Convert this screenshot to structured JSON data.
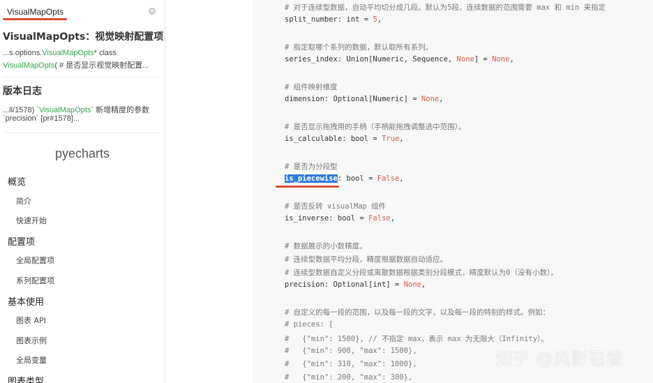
{
  "search": {
    "query": "VisualMapOpts",
    "clear_icon": "⊗"
  },
  "results": [
    {
      "title": "VisualMapOpts：视觉映射配置项",
      "line1_pre": "...s.options.",
      "line1_hl": "VisualMapOpts",
      "line1_post": "* class",
      "line2_hl": "VisualMapOpts",
      "line2_post": "( # 是否显示视觉映射配置..."
    },
    {
      "title": "版本日志",
      "line1_pre": "...ll/1578) `",
      "line1_hl": "VisualMapOpts",
      "line1_post": "` 新增精度的参数",
      "line2": "`precision` [pr#1578]..."
    }
  ],
  "brand": "pyecharts",
  "nav": [
    {
      "label": "概览",
      "level": "section"
    },
    {
      "label": "简介",
      "level": "sub"
    },
    {
      "label": "快速开始",
      "level": "sub"
    },
    {
      "label": "配置项",
      "level": "section"
    },
    {
      "label": "全局配置项",
      "level": "sub"
    },
    {
      "label": "系列配置项",
      "level": "sub"
    },
    {
      "label": "基本使用",
      "level": "section"
    },
    {
      "label": "图表 API",
      "level": "sub"
    },
    {
      "label": "图表示例",
      "level": "sub"
    },
    {
      "label": "全局变量",
      "level": "sub"
    },
    {
      "label": "图表类型",
      "level": "section"
    }
  ],
  "code": {
    "c1": "# 对于连续型数据，自动平均切分成几段。默认为5段。连续数据的范围需要 max 和 min 来指定",
    "split_pre": "split_number: int = ",
    "split_val": "5",
    "split_post": ",",
    "c2": "# 指定取哪个系列的数据，默认取所有系列。",
    "series_pre": "series_index: Union[Numeric, Sequence, ",
    "series_none1": "None",
    "series_mid": "] = ",
    "series_none2": "None",
    "series_post": ",",
    "c3": "# 组件映射维度",
    "dim_pre": "dimension: Optional[Numeric] = ",
    "dim_none": "None",
    "dim_post": ",",
    "c4": "# 是否显示拖拽用的手柄（手柄能拖拽调整选中范围）。",
    "calc_pre": "is_calculable: bool = ",
    "calc_val": "True",
    "calc_post": ",",
    "c5": "# 是否为分段型",
    "piece_sel": "is_piecewise",
    "piece_mid": ": bool = ",
    "piece_val": "False",
    "piece_post": ",",
    "c6": "# 是否反转 visualMap 组件",
    "inv_pre": "is_inverse: bool = ",
    "inv_val": "False",
    "inv_post": ",",
    "c7": "# 数据展示的小数精度。",
    "c8": "# 连续型数据平均分段，精度根据数据自动适应。",
    "c9": "# 连续型数据自定义分段或离散数据根据类别分段模式，精度默认为0（没有小数）。",
    "prec_pre": "precision: Optional[int] = ",
    "prec_none": "None",
    "prec_post": ",",
    "c10": "# 自定义的每一段的范围，以及每一段的文字，以及每一段的特别的样式。例如：",
    "c11": "# pieces: [",
    "c12": "#   {\"min\": 1500}, // 不指定 max，表示 max 为无限大（Infinity）。",
    "c13": "#   {\"min\": 900, \"max\": 1500},",
    "c14": "#   {\"min\": 310, \"max\": 1000},",
    "c15": "#   {\"min\": 200, \"max\": 300},"
  },
  "watermark": "知乎 @风影忍着"
}
